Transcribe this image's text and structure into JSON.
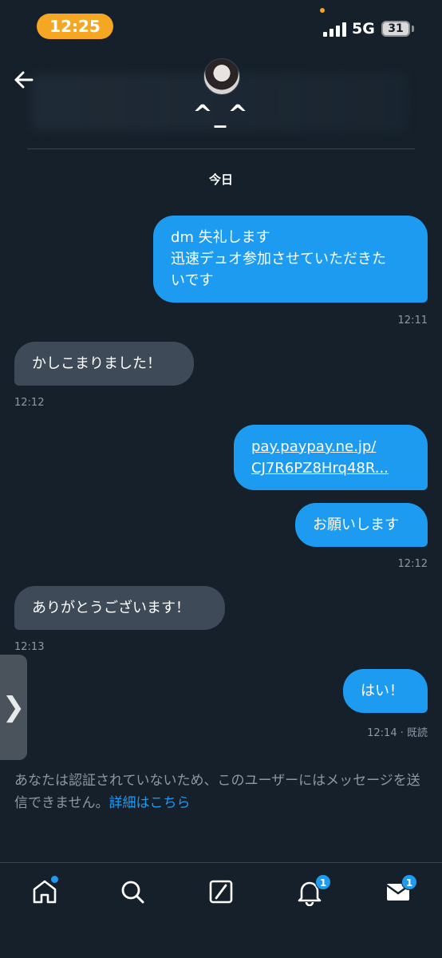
{
  "status_bar": {
    "time": "12:25",
    "network": "5G",
    "battery": "31"
  },
  "header": {
    "contact_name": "^_^",
    "back_icon": "arrow-left-icon"
  },
  "conversation": {
    "date_label": "今日",
    "messages": [
      {
        "direction": "sent",
        "lines": [
          "dm 失礼します",
          "迅速デュオ参加させていただきた",
          "いです"
        ],
        "time": "12:11"
      },
      {
        "direction": "received",
        "lines": [
          "かしこまりました！"
        ],
        "time": "12:12"
      },
      {
        "direction": "sent",
        "link_lines": [
          "pay.paypay.ne.jp/",
          "CJ7R6PZ8Hrq48R..."
        ]
      },
      {
        "direction": "sent",
        "lines": [
          "お願いします"
        ],
        "time": "12:12"
      },
      {
        "direction": "received",
        "lines": [
          "ありがとうございます！"
        ],
        "time": "12:13"
      },
      {
        "direction": "sent",
        "lines": [
          "はい！"
        ],
        "time": "12:14 · 既読"
      }
    ]
  },
  "side_tab": {
    "glyph": "❯"
  },
  "notice": {
    "text": "あなたは認証されていないため、このユーザーにはメッセージを送信できません。",
    "link": "詳細はこちら"
  },
  "bottom_nav": {
    "items": [
      {
        "icon": "home-icon",
        "dot": true
      },
      {
        "icon": "search-icon"
      },
      {
        "icon": "grok-icon"
      },
      {
        "icon": "bell-icon",
        "badge": "1"
      },
      {
        "icon": "mail-icon",
        "badge": "1"
      }
    ]
  },
  "colors": {
    "background": "#15202b",
    "sent_bubble": "#1d9bf0",
    "received_bubble": "#3e4a57",
    "accent": "#1d9bf0",
    "time_pill": "#f5a623"
  }
}
